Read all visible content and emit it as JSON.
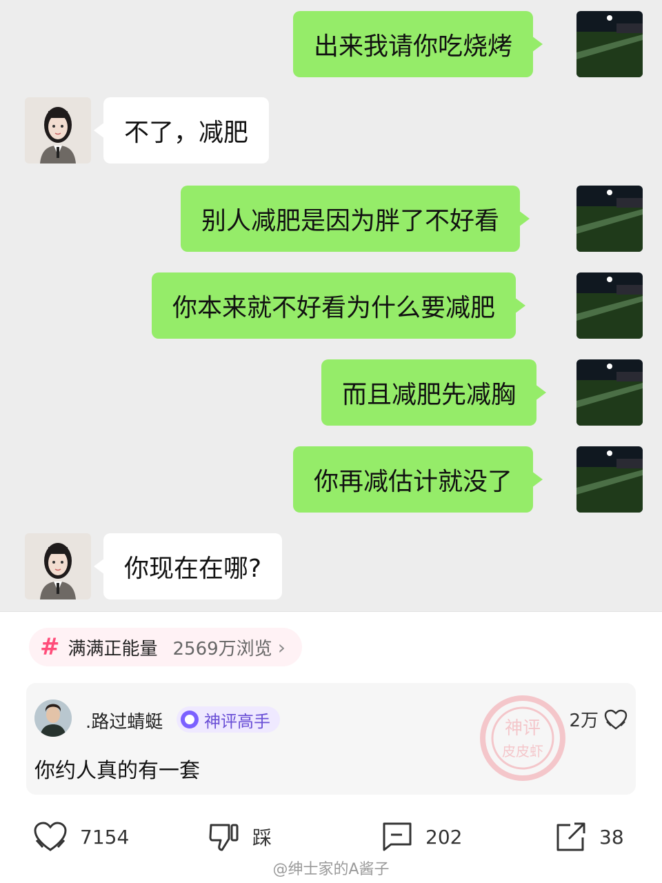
{
  "messages": [
    {
      "from": "me",
      "text": "出来我请你吃烧烤"
    },
    {
      "from": "her",
      "text": "不了，减肥"
    },
    {
      "from": "me",
      "text": "别人减肥是因为胖了不好看"
    },
    {
      "from": "me",
      "text": "你本来就不好看为什么要减肥"
    },
    {
      "from": "me",
      "text": "而且减肥先减胸"
    },
    {
      "from": "me",
      "text": "你再减估计就没了"
    },
    {
      "from": "her",
      "text": "你现在在哪?"
    }
  ],
  "topic": {
    "icon": "#",
    "name": "满满正能量",
    "views": "2569万浏览",
    "chevron": "›"
  },
  "comment": {
    "user": ".路过蜻蜓",
    "badge": "神评高手",
    "text": "你约人真的有一套",
    "likes": "2万",
    "stamp_text_top": "神评",
    "stamp_text_bottom": "皮皮虾"
  },
  "actions": {
    "like_count": "7154",
    "dislike_label": "踩",
    "comment_count": "202",
    "share_count": "38"
  },
  "watermark": "@绅士家的A酱子"
}
